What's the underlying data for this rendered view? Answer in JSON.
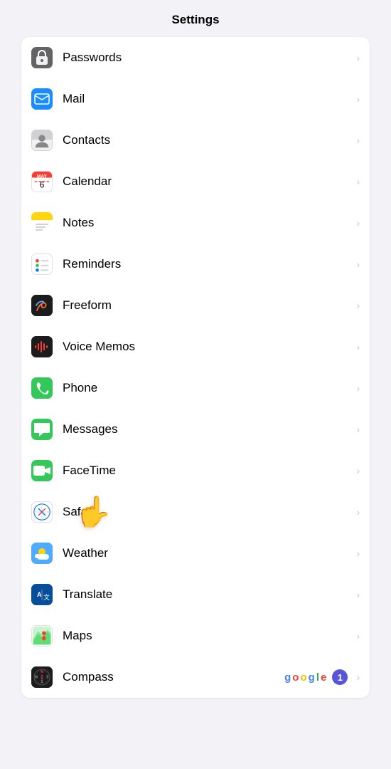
{
  "header": {
    "title": "Settings"
  },
  "rows": [
    {
      "id": "passwords",
      "label": "Passwords",
      "iconClass": "icon-passwords"
    },
    {
      "id": "mail",
      "label": "Mail",
      "iconClass": "icon-mail"
    },
    {
      "id": "contacts",
      "label": "Contacts",
      "iconClass": "icon-contacts"
    },
    {
      "id": "calendar",
      "label": "Calendar",
      "iconClass": "icon-calendar"
    },
    {
      "id": "notes",
      "label": "Notes",
      "iconClass": "icon-notes"
    },
    {
      "id": "reminders",
      "label": "Reminders",
      "iconClass": "icon-reminders"
    },
    {
      "id": "freeform",
      "label": "Freeform",
      "iconClass": "icon-freeform"
    },
    {
      "id": "voicememos",
      "label": "Voice Memos",
      "iconClass": "icon-voicememos"
    },
    {
      "id": "phone",
      "label": "Phone",
      "iconClass": "icon-phone"
    },
    {
      "id": "messages",
      "label": "Messages",
      "iconClass": "icon-messages"
    },
    {
      "id": "facetime",
      "label": "FaceTime",
      "iconClass": "icon-facetime"
    },
    {
      "id": "safari",
      "label": "Safari",
      "iconClass": "icon-safari"
    },
    {
      "id": "weather",
      "label": "Weather",
      "iconClass": "icon-weather"
    },
    {
      "id": "translate",
      "label": "Translate",
      "iconClass": "icon-translate"
    },
    {
      "id": "maps",
      "label": "Maps",
      "iconClass": "icon-maps"
    },
    {
      "id": "compass",
      "label": "Compass",
      "iconClass": "icon-compass",
      "extras": true
    }
  ],
  "compass_badge": "1",
  "cursor": "👆"
}
